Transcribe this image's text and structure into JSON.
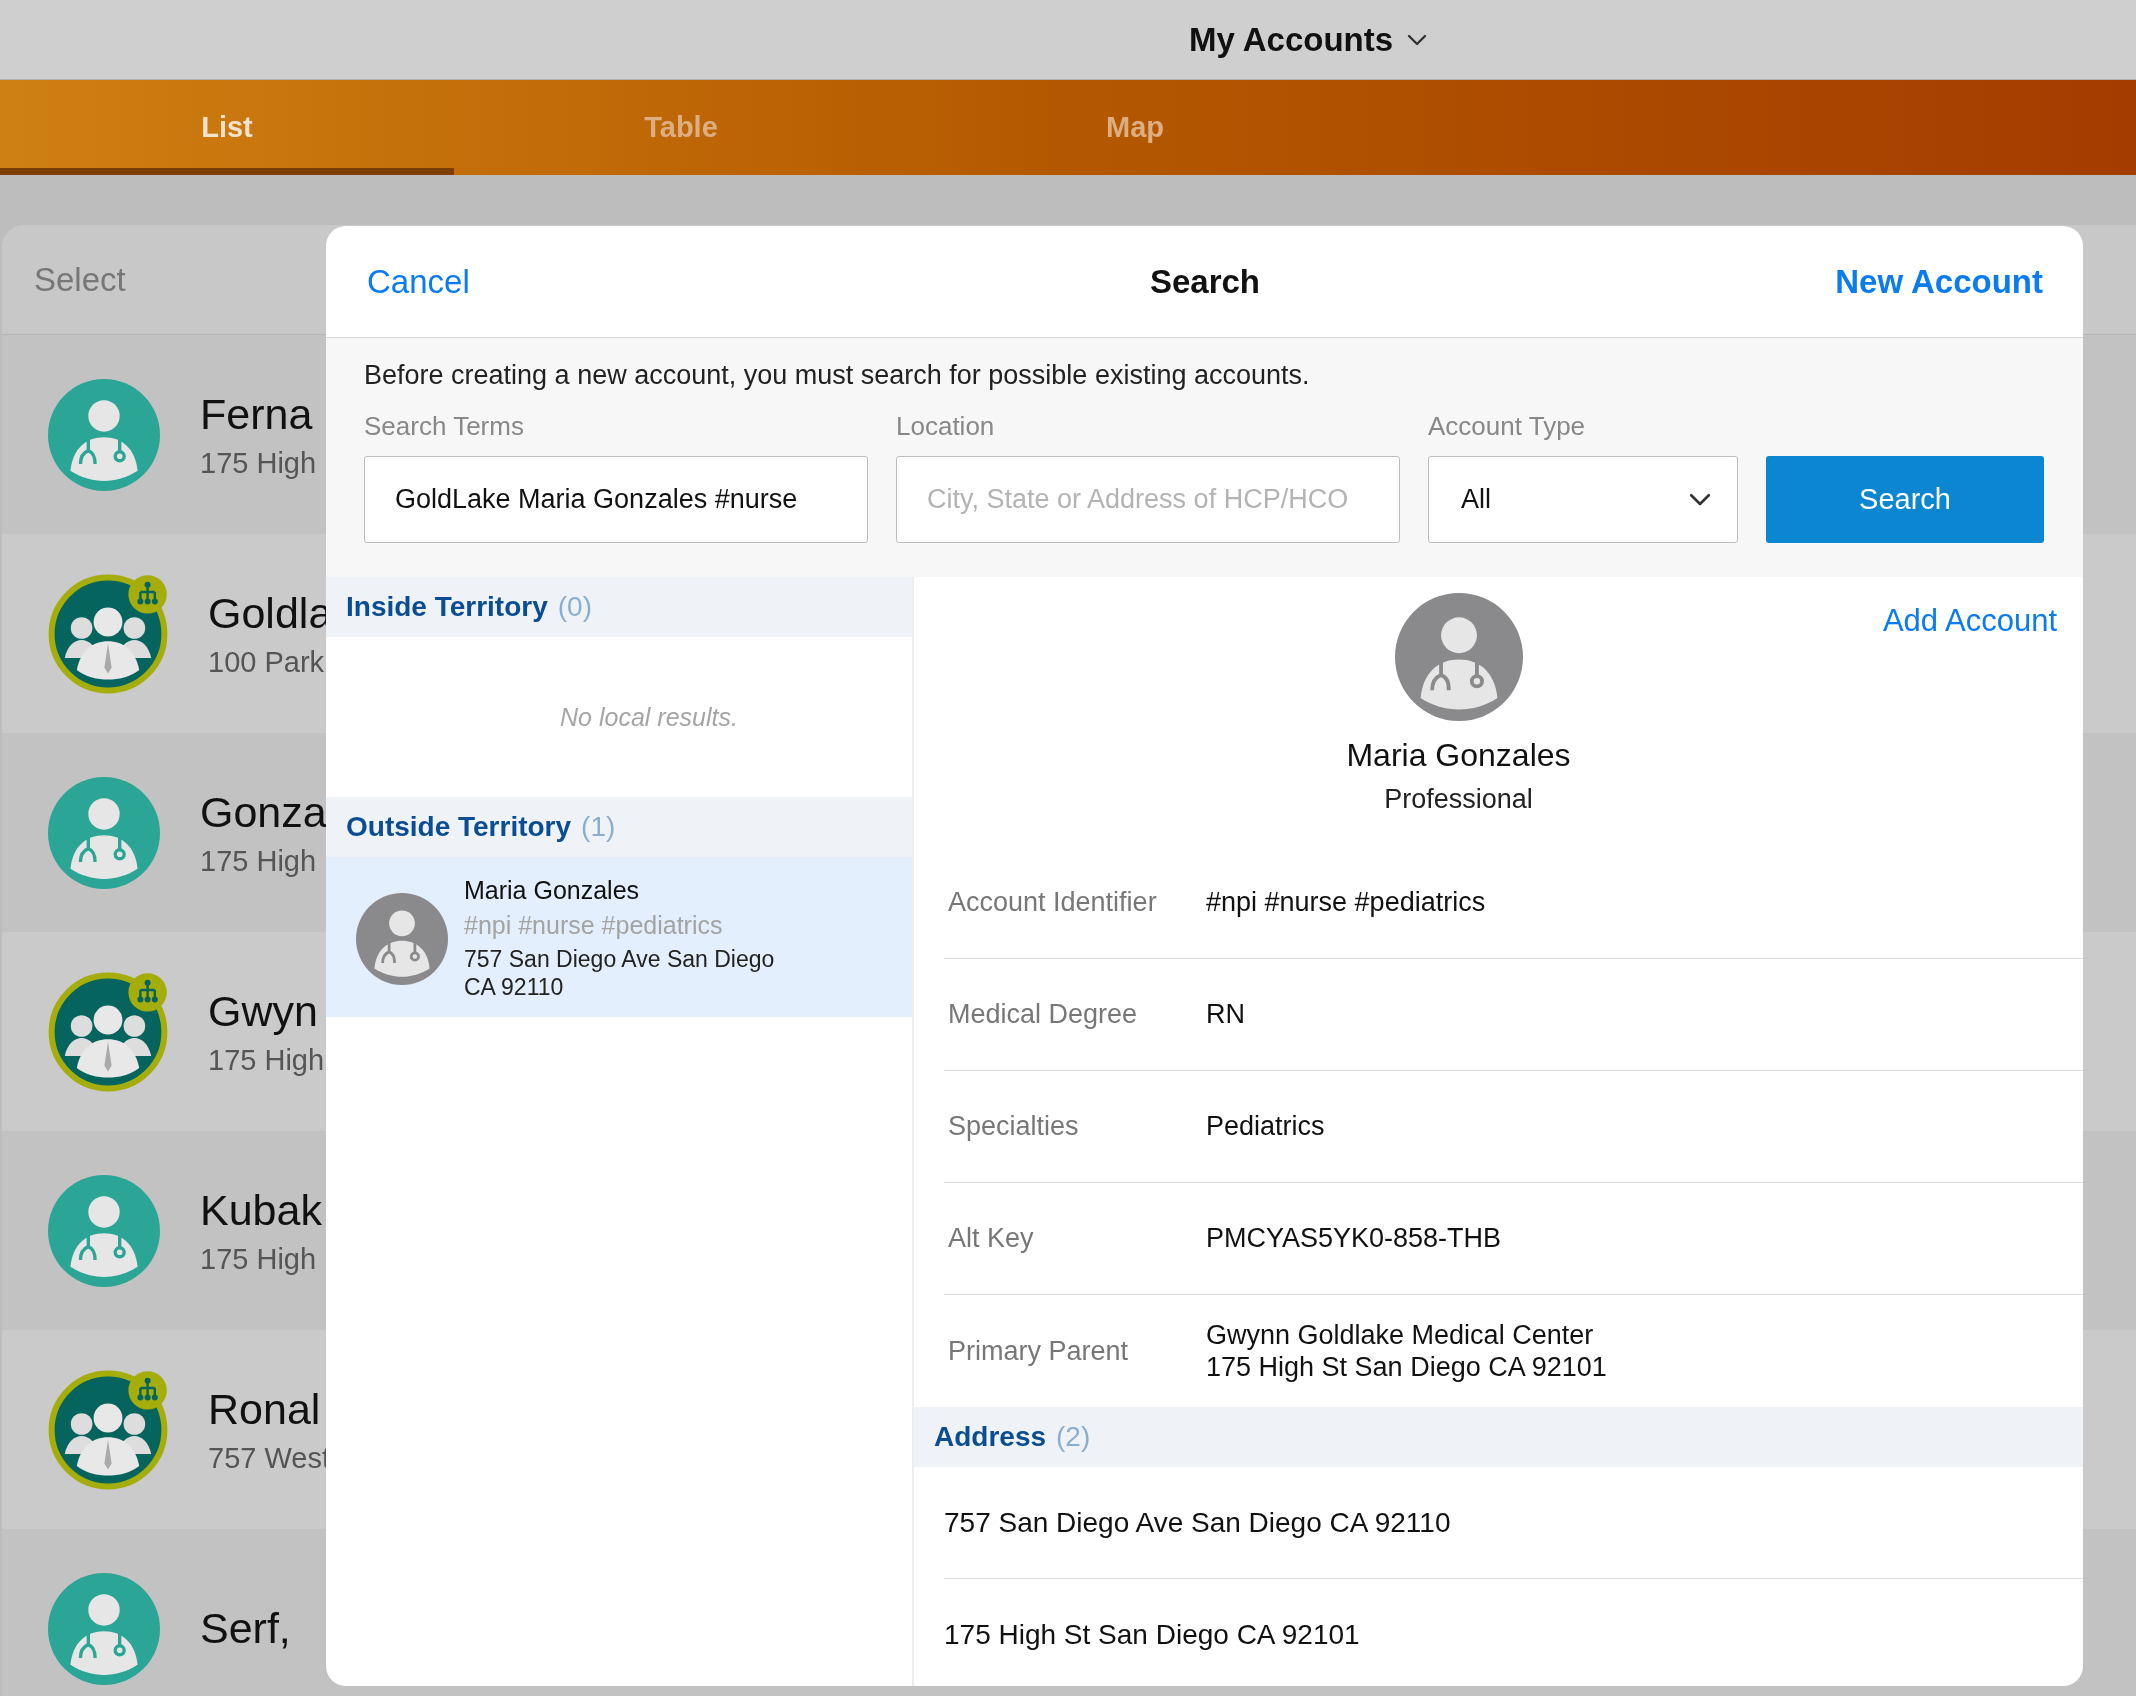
{
  "header": {
    "title": "My Accounts"
  },
  "tabs": [
    {
      "label": "List",
      "selected": true
    },
    {
      "label": "Table",
      "selected": false
    },
    {
      "label": "Map",
      "selected": false
    }
  ],
  "background_list": {
    "header": "Select",
    "rows": [
      {
        "kind": "person",
        "name": "Ferna",
        "address": "175 High"
      },
      {
        "kind": "organization",
        "name": "Goldla",
        "address": "100 Park"
      },
      {
        "kind": "person",
        "name": "Gonza",
        "address": "175 High"
      },
      {
        "kind": "organization",
        "name": "Gwyn",
        "address": "175 High"
      },
      {
        "kind": "person",
        "name": "Kubak",
        "address": "175 High"
      },
      {
        "kind": "organization",
        "name": "Ronal",
        "address": "757 West"
      },
      {
        "kind": "person",
        "name": "Serf,",
        "address": ""
      }
    ]
  },
  "modal": {
    "cancel": "Cancel",
    "title": "Search",
    "new_account": "New Account",
    "intro": "Before creating a new account, you must search for possible existing accounts.",
    "search_terms": {
      "label": "Search Terms",
      "value": "GoldLake Maria Gonzales #nurse"
    },
    "location": {
      "label": "Location",
      "placeholder": "City, State or Address of HCP/HCO"
    },
    "account_type": {
      "label": "Account Type",
      "value": "All"
    },
    "search_button": "Search",
    "results": [
      {
        "title": "Inside Territory",
        "count": "(0)",
        "empty_text": "No local results."
      },
      {
        "title": "Outside Territory",
        "count": "(1)",
        "items": [
          {
            "name": "Maria Gonzales",
            "tags": "#npi #nurse #pediatrics",
            "address": "757 San Diego Ave San Diego\nCA 92110",
            "selected": true
          }
        ]
      }
    ],
    "detail": {
      "add_account": "Add Account",
      "name": "Maria Gonzales",
      "type": "Professional",
      "fields": [
        {
          "label": "Account Identifier",
          "value": "#npi #nurse #pediatrics"
        },
        {
          "label": "Medical Degree",
          "value": "RN"
        },
        {
          "label": "Specialties",
          "value": "Pediatrics"
        },
        {
          "label": "Alt Key",
          "value": "PMCYAS5YK0-858-THB"
        },
        {
          "label": "Primary Parent",
          "value": "Gwynn Goldlake Medical Center\n175 High St San Diego CA 92101"
        }
      ],
      "address": {
        "title": "Address",
        "count": "(2)",
        "items": [
          "757 San Diego Ave San Diego CA 92110",
          "175 High St San Diego CA 92101"
        ]
      }
    }
  }
}
